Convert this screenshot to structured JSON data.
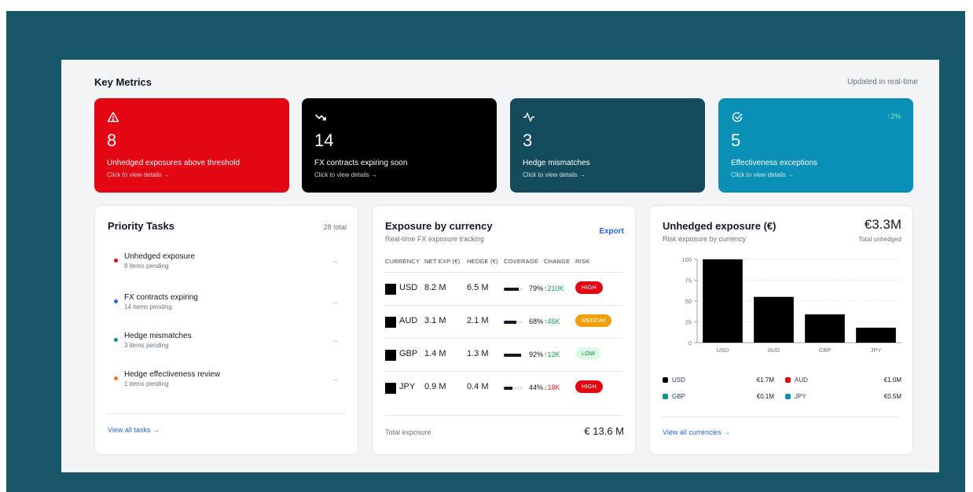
{
  "colors": {
    "frame": "#175569",
    "alert_red": "#e30613",
    "dark": "#000000",
    "teal_dark": "#144b5c",
    "blue": "#0a8fb6",
    "link": "#2563eb"
  },
  "header": {
    "title": "Key Metrics",
    "updated": "Updated in real-time"
  },
  "metrics": [
    {
      "icon": "warning-icon",
      "value": "8",
      "label": "Unhedged exposures above threshold",
      "sub": "Click to view details →",
      "color": "#e30613"
    },
    {
      "icon": "trending-down-icon",
      "value": "14",
      "label": "FX contracts expiring soon",
      "sub": "Click to view details →",
      "color": "#000000"
    },
    {
      "icon": "activity-icon",
      "value": "3",
      "label": "Hedge mismatches",
      "sub": "Click to view details →",
      "color": "#144b5c"
    },
    {
      "icon": "check-circle-icon",
      "value": "5",
      "label": "Effectiveness exceptions",
      "sub": "Click to view details →",
      "trend": "↑2%",
      "color": "#0a8fb6"
    }
  ],
  "priority_tasks": {
    "title": "Priority Tasks",
    "total": "28 total",
    "items": [
      {
        "title": "Unhedged exposure",
        "sub": "8 items pending",
        "dot": "#e30613"
      },
      {
        "title": "FX contracts expiring",
        "sub": "14 items pending",
        "dot": "#2563eb"
      },
      {
        "title": "Hedge mismatches",
        "sub": "3 items pending",
        "dot": "#0d9488"
      },
      {
        "title": "Hedge effectiveness review",
        "sub": "1 items pending",
        "dot": "#f97316"
      }
    ],
    "arrow": "→",
    "view_all": "View all tasks →"
  },
  "exposure": {
    "title": "Exposure by currency",
    "subtitle": "Real-time FX exposure tracking",
    "export": "Export",
    "columns": [
      "CURRENCY",
      "NET EXP (€)",
      "HEDGE (€)",
      "COVERAGE",
      "CHANGE",
      "RISK"
    ],
    "rows": [
      {
        "currency": "USD",
        "net": "8.2 M",
        "hedge": "6.5 M",
        "coverage": 0.79,
        "coverage_label": "79%",
        "change": "↑210K",
        "dir": "up",
        "risk": "HIGH",
        "risk_bg": "#e30613",
        "risk_fg": "#ffffff"
      },
      {
        "currency": "AUD",
        "net": "3.1 M",
        "hedge": "2.1 M",
        "coverage": 0.68,
        "coverage_label": "68%",
        "change": "↑45K",
        "dir": "up",
        "risk": "MEDIUM",
        "risk_bg": "#f59e0b",
        "risk_fg": "#ffffff"
      },
      {
        "currency": "GBP",
        "net": "1.4 M",
        "hedge": "1.3 M",
        "coverage": 0.92,
        "coverage_label": "92%",
        "change": "↑12K",
        "dir": "up",
        "risk": "LOW",
        "risk_bg": "#dcfce7",
        "risk_fg": "#15803d"
      },
      {
        "currency": "JPY",
        "net": "0.9 M",
        "hedge": "0.4 M",
        "coverage": 0.44,
        "coverage_label": "44%",
        "change": "↓18K",
        "dir": "down",
        "risk": "HIGH",
        "risk_bg": "#e30613",
        "risk_fg": "#ffffff"
      }
    ],
    "total_label": "Total exposure",
    "total_value": "€ 13.6 M"
  },
  "unhedged": {
    "title": "Unhedged exposure (€)",
    "subtitle": "Risk exposure by currency",
    "total": "€3.3M",
    "total_label": "Total unhedged",
    "legend": [
      {
        "name": "USD",
        "value": "€1.7M",
        "color": "#000000"
      },
      {
        "name": "AUD",
        "value": "€1.0M",
        "color": "#e30613"
      },
      {
        "name": "GBP",
        "value": "€0.1M",
        "color": "#0d9488"
      },
      {
        "name": "JPY",
        "value": "€0.5M",
        "color": "#0a8fb6"
      }
    ],
    "view_all": "View all currencies →"
  },
  "chart_data": {
    "type": "bar",
    "categories": [
      "USD",
      "AUD",
      "GBP",
      "JPY"
    ],
    "values": [
      100,
      55,
      34,
      18
    ],
    "yticks": [
      0,
      25,
      50,
      75,
      100
    ],
    "ylim": [
      0,
      100
    ],
    "bar_color": "#000000",
    "grid": true
  }
}
